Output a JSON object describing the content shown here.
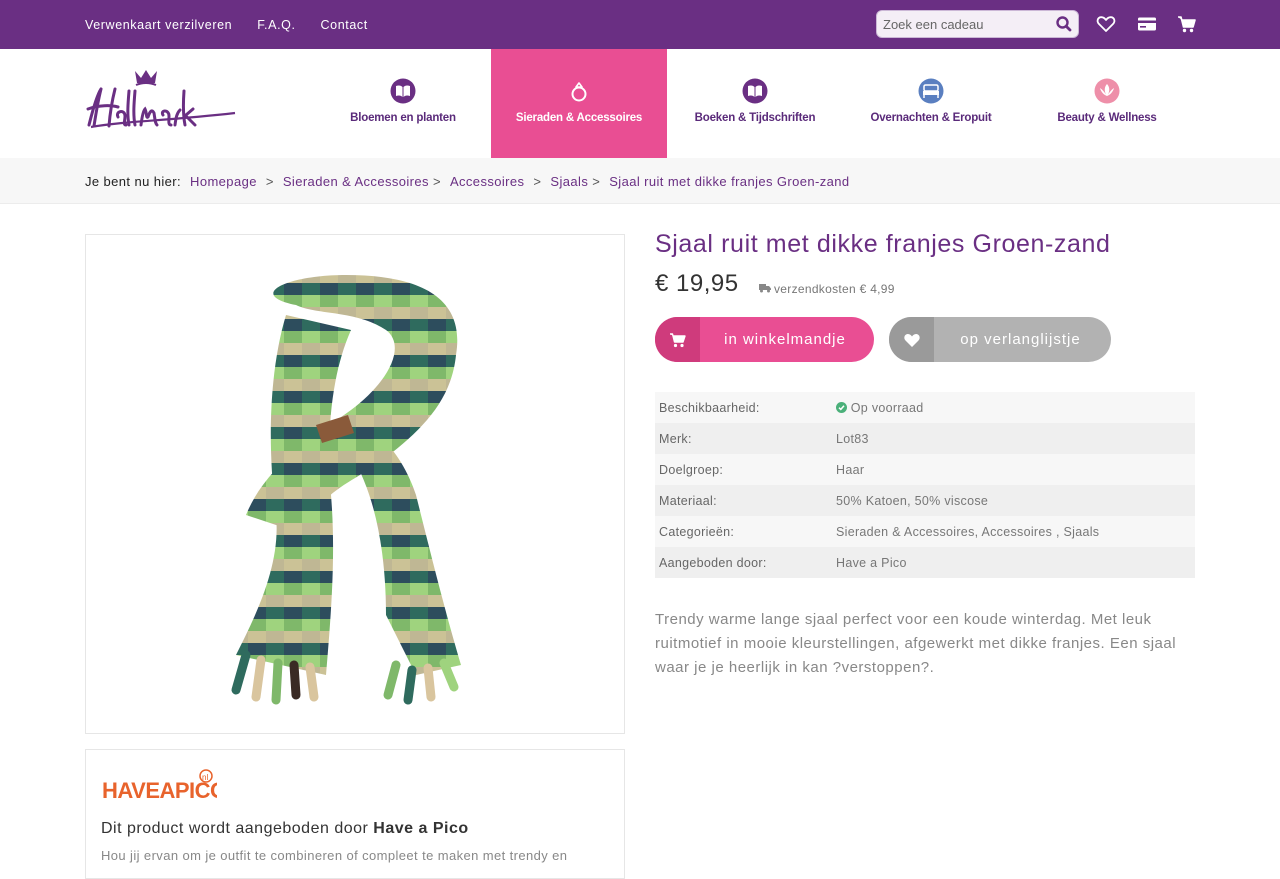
{
  "topbar": {
    "links": [
      "Verwenkaart verzilveren",
      "F.A.Q.",
      "Contact"
    ],
    "search_placeholder": "Zoek een cadeau",
    "icons": [
      "search-icon",
      "heart-icon",
      "credit-card-icon",
      "cart-icon"
    ]
  },
  "brand": {
    "name": "Hallmark"
  },
  "nav": {
    "items": [
      {
        "label": "Bloemen en planten",
        "icon": "book-icon"
      },
      {
        "label": "Sieraden & Accessoires",
        "icon": "ring-icon",
        "active": true
      },
      {
        "label": "Boeken & Tijdschriften",
        "icon": "book-icon"
      },
      {
        "label": "Overnachten & Eropuit",
        "icon": "bed-icon"
      },
      {
        "label": "Beauty & Wellness",
        "icon": "lotus-icon"
      }
    ]
  },
  "breadcrumb": {
    "prefix": "Je bent nu hier:",
    "items": [
      "Homepage",
      "Sieraden & Accessoires",
      "Accessoires",
      "Sjaals",
      "Sjaal ruit met dikke franjes Groen-zand"
    ],
    "separator": ">"
  },
  "product": {
    "title": "Sjaal ruit met dikke franjes Groen-zand",
    "price": "€ 19,95",
    "shipping": "verzendkosten € 4,99",
    "cart_button": "in winkelmandje",
    "wishlist_button": "op verlanglijstje",
    "specs": [
      {
        "key": "Beschikbaarheid:",
        "value": "Op voorraad"
      },
      {
        "key": "Merk:",
        "value": "Lot83"
      },
      {
        "key": "Doelgroep:",
        "value": "Haar"
      },
      {
        "key": "Materiaal:",
        "value": "50% Katoen, 50% viscose"
      },
      {
        "key": "Categorieën:",
        "value": [
          "Sieraden & Accessoires",
          "Accessoires",
          "Sjaals"
        ]
      },
      {
        "key": "Aangeboden door:",
        "value": "Have a Pico"
      }
    ],
    "description": "Trendy warme lange sjaal perfect voor een koude winterdag. Met leuk ruitmotief in mooie kleurstellingen, afgewerkt met dikke franjes. Een sjaal waar je je heerlijk in kan ?verstoppen?."
  },
  "seller": {
    "logo_text": "HAVEAPICO",
    "logo_suffix": "nl",
    "title_prefix": "Dit product wordt aangeboden door",
    "title_name": "Have a Pico",
    "text": "Hou jij ervan om je outfit te combineren of compleet te maken met trendy en"
  },
  "colors": {
    "purple": "#6a2f83",
    "pink": "#e94e93",
    "green": "#4bb07a",
    "grey_button": "#b2b2b2"
  }
}
